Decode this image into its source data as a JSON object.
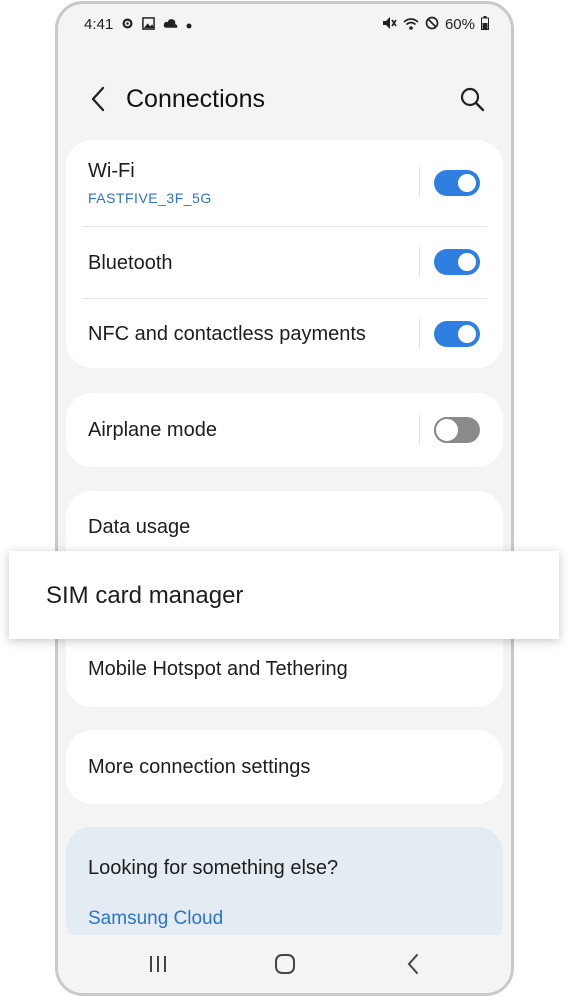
{
  "status_bar": {
    "time": "4:41",
    "left_icons": [
      "gear-icon",
      "gallery-icon",
      "cloud-icon",
      "dot-icon"
    ],
    "right_icons": [
      "mute-icon",
      "wifi-icon",
      "no-disturb-icon"
    ],
    "battery": "60%"
  },
  "header": {
    "title": "Connections",
    "back_icon": "chevron-left-icon",
    "search_icon": "search-icon"
  },
  "wireless": {
    "wifi": {
      "label": "Wi-Fi",
      "network": "FASTFIVE_3F_5G",
      "enabled": true
    },
    "bluetooth": {
      "label": "Bluetooth",
      "enabled": true
    },
    "nfc": {
      "label": "NFC and contactless payments",
      "enabled": true
    }
  },
  "airplane": {
    "label": "Airplane mode",
    "enabled": false
  },
  "items": {
    "data_usage": "Data usage",
    "sim_manager": "SIM card manager",
    "hotspot": "Mobile Hotspot and Tethering",
    "more": "More connection settings"
  },
  "suggestions": {
    "title": "Looking for something else?",
    "link": "Samsung Cloud"
  },
  "nav": {
    "recents_icon": "recents-icon",
    "home_icon": "home-icon",
    "back_icon": "back-icon"
  },
  "colors": {
    "accent": "#2f7fe0",
    "link": "#2d73c8",
    "background": "#f4f4f4",
    "suggestion_bg": "#e4ecf3"
  }
}
